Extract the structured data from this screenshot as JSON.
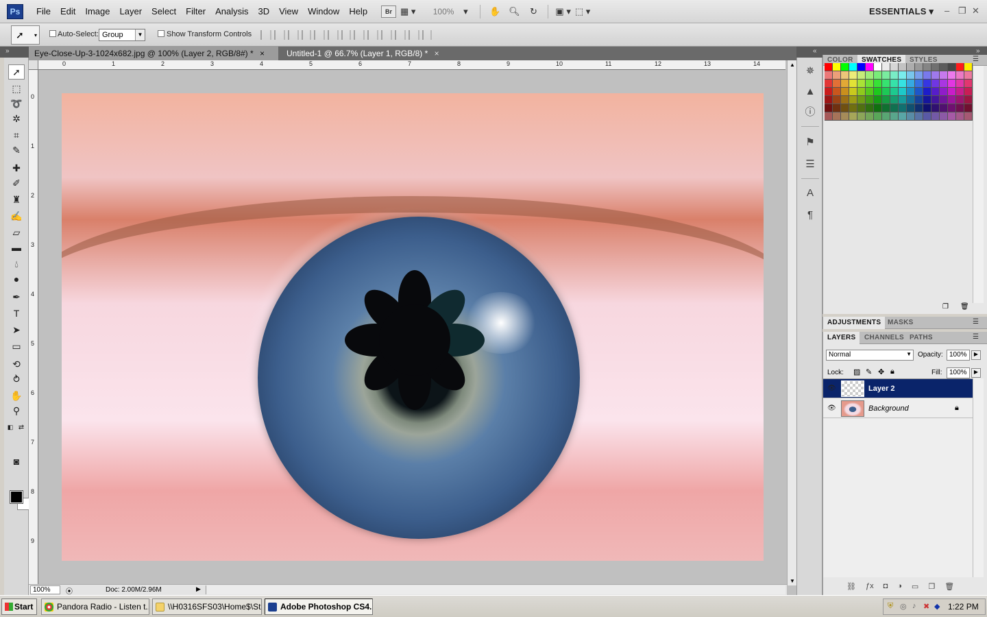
{
  "app": {
    "logo": "Ps",
    "menu": [
      "File",
      "Edit",
      "Image",
      "Layer",
      "Select",
      "Filter",
      "Analysis",
      "3D",
      "View",
      "Window",
      "Help"
    ],
    "bridge_label": "Br",
    "zoom_level": "100%",
    "workspace": "ESSENTIALS"
  },
  "options_bar": {
    "auto_select_label": "Auto-Select:",
    "auto_select_value": "Group",
    "transform_label": "Show Transform Controls"
  },
  "documents": {
    "tabs": [
      {
        "label": "Eye-Close-Up-3-1024x682.jpg @ 100% (Layer 2, RGB/8#) *",
        "active": true,
        "close": "×"
      },
      {
        "label": "Untitled-1 @ 66.7% (Layer 1, RGB/8) *",
        "active": false,
        "close": "×"
      }
    ]
  },
  "rulers": {
    "horizontal": [
      "0",
      "1",
      "2",
      "3",
      "4",
      "5",
      "6",
      "7",
      "8",
      "9",
      "10",
      "11",
      "12",
      "13",
      "14"
    ],
    "vertical": [
      "0",
      "1",
      "2",
      "3",
      "4",
      "5",
      "6",
      "7",
      "8",
      "9"
    ]
  },
  "status": {
    "zoom": "100%",
    "doc": "Doc: 2.00M/2.96M"
  },
  "color_panel": {
    "tabs": [
      "COLOR",
      "SWATCHES",
      "STYLES"
    ],
    "active": "SWATCHES"
  },
  "adjust_panel": {
    "tabs": [
      "ADJUSTMENTS",
      "MASKS"
    ]
  },
  "layers_panel": {
    "tabs": [
      "LAYERS",
      "CHANNELS",
      "PATHS"
    ],
    "blend_mode": "Normal",
    "opacity_label": "Opacity:",
    "opacity": "100%",
    "lock_label": "Lock:",
    "fill_label": "Fill:",
    "fill": "100%",
    "layers": [
      {
        "name": "Layer 2",
        "selected": true
      },
      {
        "name": "Background",
        "selected": false,
        "locked": true
      }
    ]
  },
  "taskbar": {
    "start": "Start",
    "items": [
      "Pandora Radio - Listen t...",
      "\\\\H0316SFS03\\Home$\\St...",
      "Adobe Photoshop CS4..."
    ],
    "clock": "1:22 PM"
  },
  "swatch_colors": [
    "#ff0000",
    "#ffff00",
    "#00ff00",
    "#00ffff",
    "#0000ff",
    "#ff00ff",
    "#ffffff",
    "#ebebeb",
    "#d6d6d6",
    "#c2c2c2",
    "#adadad",
    "#999999",
    "#858585",
    "#707070",
    "#5c5c5c",
    "#474747",
    "#ff1a1a",
    "#ffec00"
  ],
  "colors": {
    "accent": "#0a246a",
    "ps_blue": "#1b3f8f",
    "canvas_bg": "#c0c0c0"
  }
}
